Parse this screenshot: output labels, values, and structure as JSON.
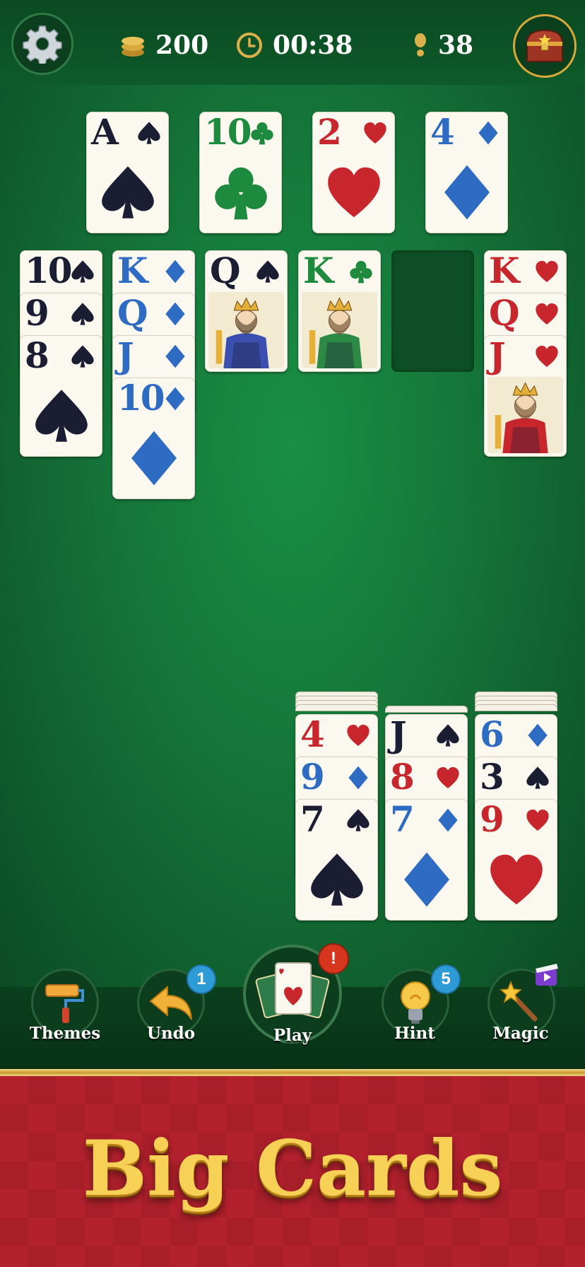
{
  "hud": {
    "coins": "200",
    "timer": "00:38",
    "moves": "38"
  },
  "foundations": [
    {
      "rank": "A",
      "suit": "spade",
      "color": "black"
    },
    {
      "rank": "10",
      "suit": "club",
      "color": "green"
    },
    {
      "rank": "2",
      "suit": "heart",
      "color": "red"
    },
    {
      "rank": "4",
      "suit": "diamond",
      "color": "blue"
    }
  ],
  "tableau": [
    [
      {
        "rank": "10",
        "suit": "spade",
        "color": "black"
      },
      {
        "rank": "9",
        "suit": "spade",
        "color": "black"
      },
      {
        "rank": "8",
        "suit": "spade",
        "color": "black"
      }
    ],
    [
      {
        "rank": "K",
        "suit": "diamond",
        "color": "blue"
      },
      {
        "rank": "Q",
        "suit": "diamond",
        "color": "blue"
      },
      {
        "rank": "J",
        "suit": "diamond",
        "color": "blue"
      },
      {
        "rank": "10",
        "suit": "diamond",
        "color": "blue"
      }
    ],
    [
      {
        "rank": "Q",
        "suit": "spade",
        "color": "black",
        "face": "queen"
      }
    ],
    [
      {
        "rank": "K",
        "suit": "club",
        "color": "green",
        "face": "king"
      }
    ],
    [],
    [
      {
        "rank": "K",
        "suit": "heart",
        "color": "red"
      },
      {
        "rank": "Q",
        "suit": "heart",
        "color": "red"
      },
      {
        "rank": "J",
        "suit": "heart",
        "color": "red",
        "face": "jack"
      }
    ]
  ],
  "reserve": [
    [
      {
        "rank": "4",
        "suit": "heart",
        "color": "red"
      },
      {
        "rank": "9",
        "suit": "diamond",
        "color": "blue"
      },
      {
        "rank": "7",
        "suit": "spade",
        "color": "black"
      }
    ],
    [
      {
        "rank": "J",
        "suit": "spade",
        "color": "black"
      },
      {
        "rank": "8",
        "suit": "heart",
        "color": "red"
      },
      {
        "rank": "7",
        "suit": "diamond",
        "color": "blue"
      }
    ],
    [
      {
        "rank": "6",
        "suit": "diamond",
        "color": "blue"
      },
      {
        "rank": "3",
        "suit": "spade",
        "color": "black"
      },
      {
        "rank": "9",
        "suit": "heart",
        "color": "red"
      }
    ]
  ],
  "toolbar": {
    "themes_label": "Themes",
    "undo_label": "Undo",
    "undo_badge": "1",
    "play_label": "Play",
    "play_alert": "!",
    "hint_label": "Hint",
    "hint_badge": "5",
    "magic_label": "Magic"
  },
  "banner": {
    "title": "Big Cards"
  },
  "colors": {
    "felt": "#15773a",
    "red": "#c8262d",
    "black": "#1b1d33",
    "blue": "#2e6bc2",
    "green": "#1e8a3e",
    "banner": "#b3212d",
    "gold": "#f7d155"
  }
}
